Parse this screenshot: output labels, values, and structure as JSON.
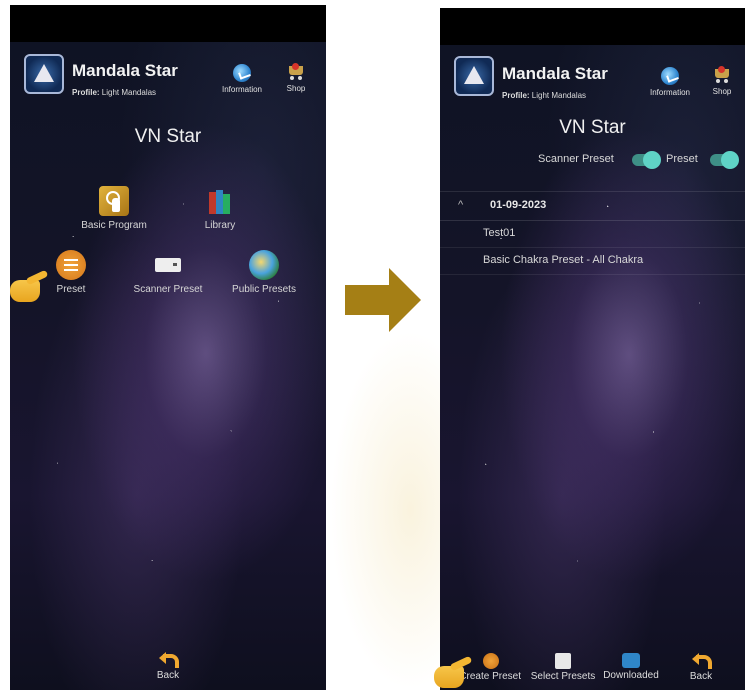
{
  "left_screen": {
    "header": {
      "app_title": "Mandala Star",
      "profile_label": "Profile:",
      "profile_value": "Light Mandalas",
      "information_label": "Information",
      "shop_label": "Shop"
    },
    "device_title": "VN Star",
    "menu": {
      "basic_program": "Basic Program",
      "library": "Library",
      "preset": "Preset",
      "scanner_preset": "Scanner Preset",
      "public_presets": "Public Presets"
    },
    "back_label": "Back"
  },
  "right_screen": {
    "header": {
      "app_title": "Mandala Star",
      "profile_label": "Profile:",
      "profile_value": "Light Mandalas",
      "information_label": "Information",
      "shop_label": "Shop"
    },
    "device_title": "VN Star",
    "toggles": {
      "scanner_preset_label": "Scanner Preset",
      "preset_label": "Preset"
    },
    "group": {
      "date": "01-09-2023",
      "items": [
        "Test01",
        "Basic Chakra Preset - All Chakra"
      ]
    },
    "bottom_bar": {
      "create_preset": "Create Preset",
      "select_presets": "Select Presets",
      "downloaded": "Downloaded",
      "back": "Back"
    }
  },
  "colors": {
    "arrow": "#a57f15",
    "toggle_on": "#5fd3c6",
    "accent_orange": "#f0a830"
  }
}
